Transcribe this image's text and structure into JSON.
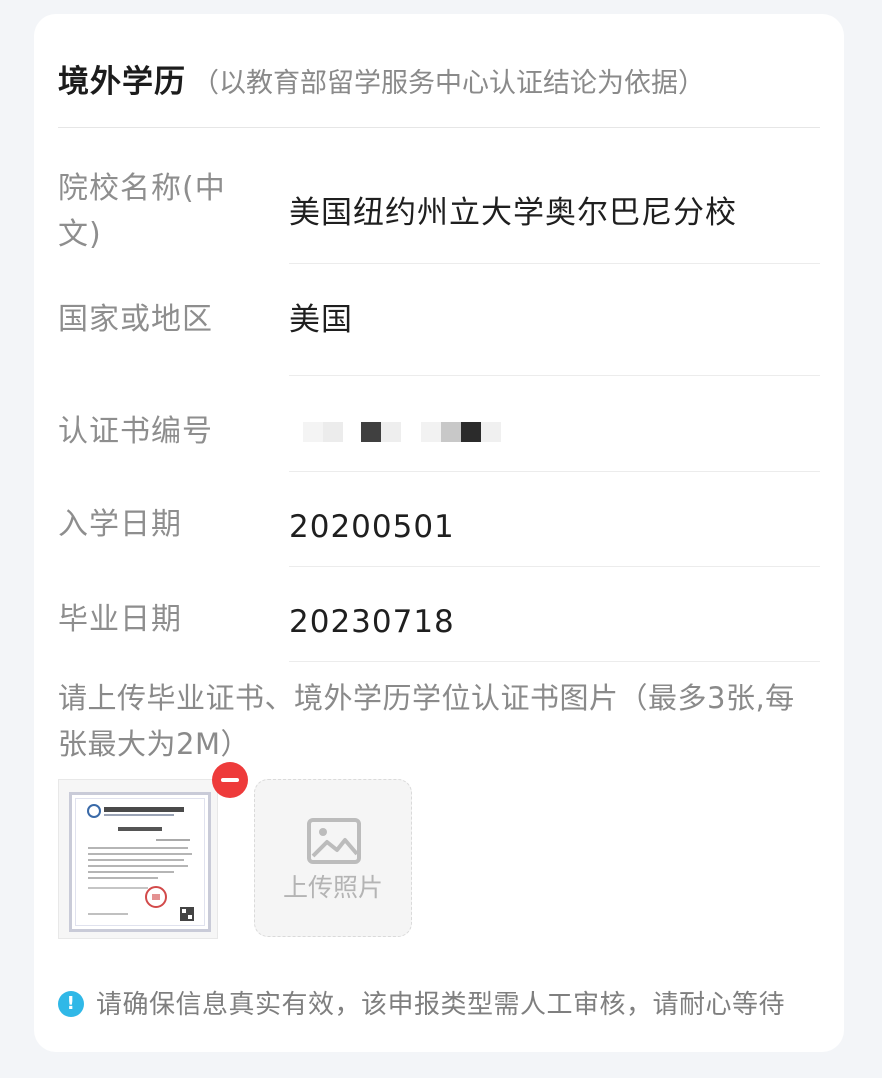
{
  "card": {
    "title": "境外学历",
    "subtitle": "（以教育部留学服务中心认证结论为依据）"
  },
  "fields": [
    {
      "label": "院校名称(中文)",
      "value": "美国纽约州立大学奥尔巴尼分校"
    },
    {
      "label": "国家或地区",
      "value": "美国"
    },
    {
      "label": "认证书编号",
      "value": ""
    },
    {
      "label": "入学日期",
      "value": "20200501"
    },
    {
      "label": "毕业日期",
      "value": "20230718"
    }
  ],
  "upload": {
    "hint": "请上传毕业证书、境外学历学位认证书图片（最多3张,每张最大为2M）",
    "button_label": "上传照片",
    "icon": "image-icon",
    "remove_icon": "minus-circle-icon"
  },
  "notice": {
    "icon": "info-icon",
    "text": "请确保信息真实有效，该申报类型需人工审核，请耐心等待"
  },
  "colors": {
    "accent_info": "#30b8e7",
    "remove_red": "#ee3b3b",
    "label_gray": "#8e8e8e",
    "background": "#f3f5f8"
  }
}
